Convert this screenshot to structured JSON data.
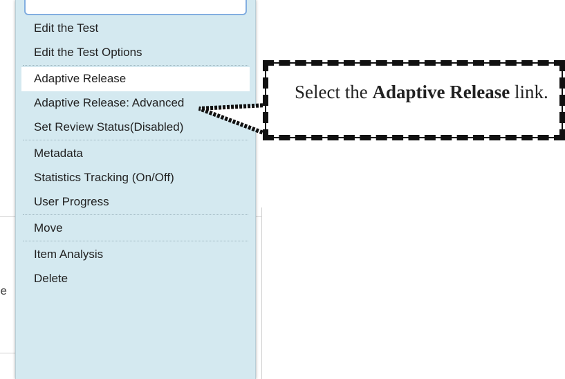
{
  "background": {
    "fragment_text": "le"
  },
  "menu": {
    "groups": [
      {
        "items": [
          {
            "label": "Edit the Test"
          },
          {
            "label": "Edit the Test Options"
          }
        ]
      },
      {
        "items": [
          {
            "label": "Adaptive Release",
            "highlighted": true
          },
          {
            "label": "Adaptive Release: Advanced"
          },
          {
            "label": "Set Review Status(Disabled)"
          }
        ]
      },
      {
        "items": [
          {
            "label": "Metadata"
          },
          {
            "label": "Statistics Tracking (On/Off)"
          },
          {
            "label": "User Progress"
          }
        ]
      },
      {
        "items": [
          {
            "label": "Move"
          }
        ]
      },
      {
        "items": [
          {
            "label": "Item Analysis"
          },
          {
            "label": "Delete"
          }
        ]
      }
    ]
  },
  "callout": {
    "prefix": "Select the ",
    "bold": "Adaptive Release",
    "suffix": " link."
  }
}
